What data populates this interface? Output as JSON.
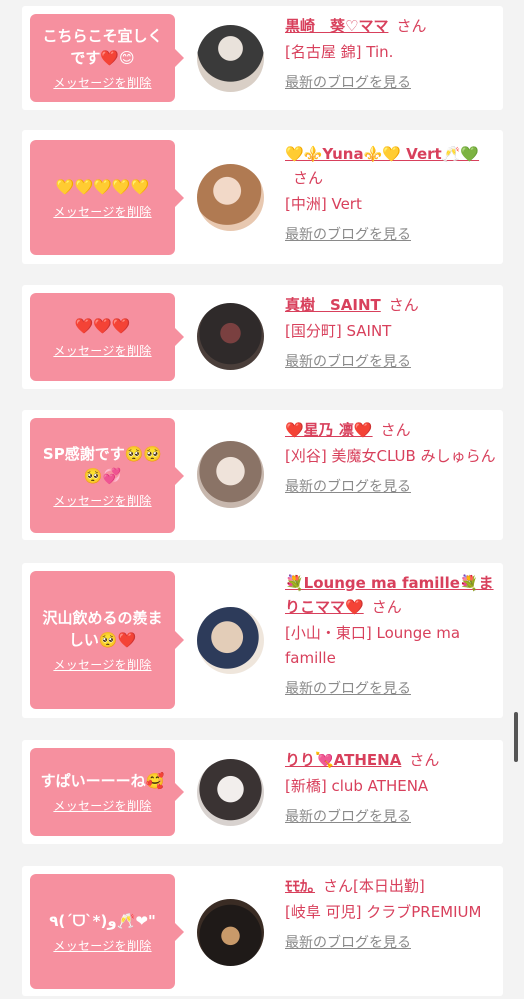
{
  "list": {
    "delete_label": "メッセージを削除",
    "blog_label": "最新のブログを見る",
    "honorific": "さん",
    "items": [
      {
        "message": "こちらこそ宜しくです❤️😊",
        "name": "黒崎　葵♡ママ",
        "shop": "[名古屋 錦] Tin.",
        "avatar_colors": [
          "#3a3a3a",
          "#d9cfc6"
        ]
      },
      {
        "message": "💛💛💛💛💛",
        "name": "💛⚜️Yuna⚜️💛 Vert🥂💚",
        "shop": "[中洲] Vert",
        "avatar_colors": [
          "#b07a52",
          "#e8c8b0"
        ]
      },
      {
        "message": "❤️❤️❤️",
        "name": "真樹　SAINT",
        "shop": "[国分町] SAINT",
        "avatar_colors": [
          "#2f2a2a",
          "#7a4040"
        ]
      },
      {
        "message": "SP感謝です🥺🥺🥺💞",
        "name": "❤️星乃 凛❤️",
        "shop": "[刈谷] 美魔女CLUB みしゅらん",
        "avatar_colors": [
          "#c7b7ad",
          "#efe3da"
        ]
      },
      {
        "message": "沢山飲めるの羨ましい🥺❤️",
        "name": "💐Lounge ma famille💐まりこママ❤️",
        "shop": "[小山・東口] Lounge ma famille",
        "avatar_colors": [
          "#e3cdb8",
          "#2d3b5a"
        ]
      },
      {
        "message": "すぱいーーーね🥰",
        "name": "りり💘ATHENA",
        "shop": "[新橋] club ATHENA",
        "avatar_colors": [
          "#d8d2cf",
          "#3a3333"
        ]
      },
      {
        "message": "٩(ˊᗜˋ*)و🥂❤︎\"",
        "name": "ﾓﾓｶ｡",
        "status": "[本日出勤]",
        "shop": "[岐阜 可児] クラブPREMIUM",
        "avatar_colors": [
          "#1f1a18",
          "#c89a6a"
        ]
      }
    ]
  }
}
